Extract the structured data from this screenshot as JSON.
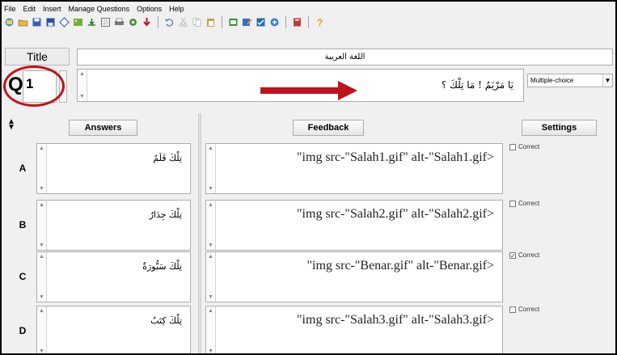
{
  "menu": [
    "File",
    "Edit",
    "Insert",
    "Manage Questions",
    "Options",
    "Help"
  ],
  "toolbar_icons": [
    "new-quiz-icon",
    "open-icon",
    "save-icon",
    "save-as-icon",
    "diamond-icon",
    "image-icon",
    "export-icon",
    "grid-icon",
    "print-icon",
    "settings-icon",
    "download-icon",
    "undo-icon",
    "cut-icon",
    "copy-icon",
    "paste-icon",
    "preview-icon",
    "edit-icon",
    "test-icon",
    "publish-icon",
    "help-book-icon",
    "help-icon"
  ],
  "title": {
    "label": "Title",
    "value": "اللغة العربية"
  },
  "question": {
    "letter": "Q",
    "number": "1",
    "text": "يَا مَرْيَمُ ! مَا تِلْكَ ؟",
    "type": "Multiple-choice"
  },
  "headers": {
    "answers": "Answers",
    "feedback": "Feedback",
    "settings": "Settings"
  },
  "correct_label": "Correct",
  "answers": [
    {
      "letter": "A",
      "text": "تِلْكَ قَلَمٌ",
      "feedback": "\"img src-\"Salah1.gif\" alt-\"Salah1.gif>",
      "correct": false
    },
    {
      "letter": "B",
      "text": "تِلْكَ جِدَارٌ",
      "feedback": "\"img src-\"Salah2.gif\" alt-\"Salah2.gif>",
      "correct": false
    },
    {
      "letter": "C",
      "text": "تِلْكَ سَبُّورَةٌ",
      "feedback": "\"img src-\"Benar.gif\" alt-\"Benar.gif>",
      "correct": true
    },
    {
      "letter": "D",
      "text": "تِلْكَ كِتَبٌ",
      "feedback": "\"img src-\"Salah3.gif\" alt-\"Salah3.gif>",
      "correct": false
    }
  ],
  "colors": {
    "highlight": "#c0121b",
    "arrow": "#c0121b"
  }
}
